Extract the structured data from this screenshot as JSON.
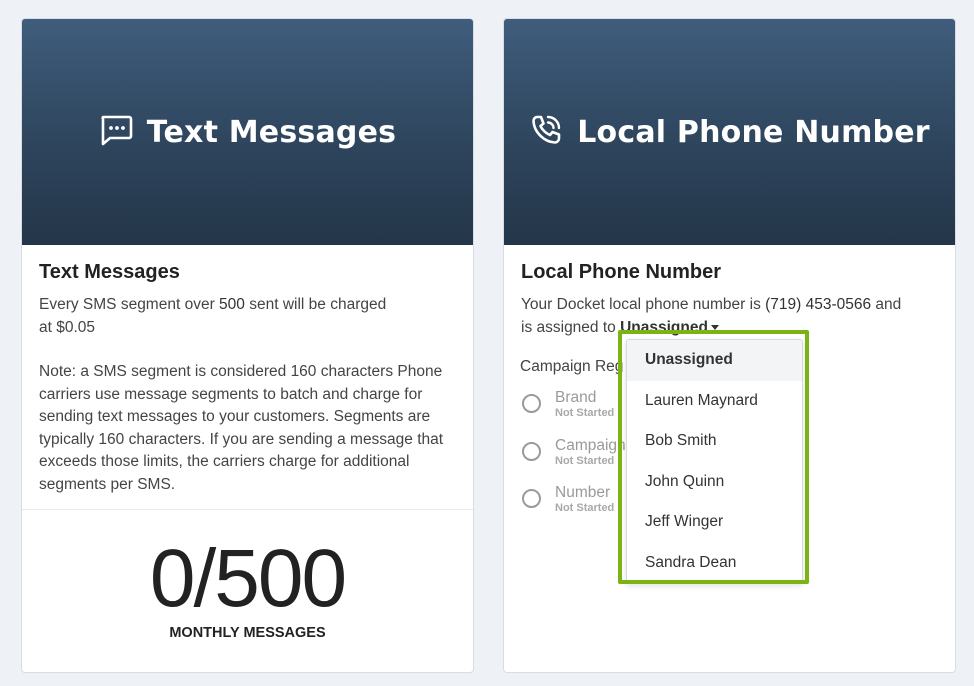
{
  "sms_card": {
    "banner_title": "Text Messages",
    "title": "Text Messages",
    "desc_line1_prefix": "Every SMS segment over ",
    "desc_count": "500",
    "desc_line1_suffix": " sent will be charged",
    "desc_line2": "at $0.05",
    "note": "Note: a SMS segment is considered 160 characters Phone carriers use message segments to batch and charge for sending text messages to your customers. Segments are typically 160 characters. If you are sending a message that exceeds those limits, the carriers charge for additional segments per SMS.",
    "usage": "0/500",
    "usage_label": "MONTHLY MESSAGES",
    "icon": "chat-bubble-icon"
  },
  "phone_card": {
    "banner_title": "Local Phone Number",
    "title": "Local Phone Number",
    "desc_prefix": "Your Docket local phone number is ",
    "phone_number": "(719) 453-0566",
    "desc_mid": " and",
    "assigned_prefix": "is assigned to ",
    "assigned_value": "Unassigned",
    "assigned_suffix": ".",
    "campaign_title": "Campaign Reg",
    "steps": [
      {
        "name": "Brand",
        "status": "Not Started"
      },
      {
        "name": "Campaign",
        "status": "Not Started"
      },
      {
        "name": "Number",
        "status": "Not Started"
      }
    ],
    "icon": "phone-call-icon"
  },
  "dropdown": {
    "options": [
      "Unassigned",
      "Lauren Maynard",
      "Bob Smith",
      "John Quinn",
      "Jeff Winger",
      "Sandra Dean"
    ],
    "selected": "Unassigned"
  },
  "colors": {
    "banner": "#33506b",
    "highlight": "#7cb314"
  }
}
